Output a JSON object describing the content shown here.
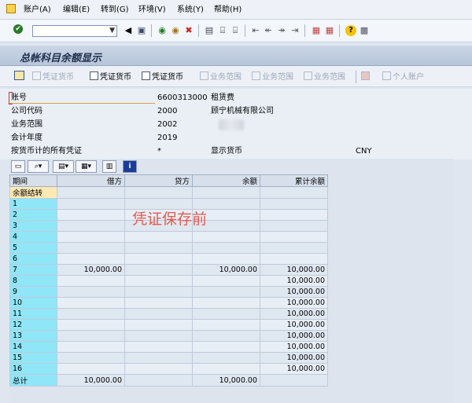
{
  "menu": {
    "items": [
      "账户(A)",
      "编辑(E)",
      "转到(G)",
      "环境(V)",
      "系统(Y)",
      "帮助(H)"
    ]
  },
  "title": "总帐科目余额显示",
  "app_toolbar": {
    "items": [
      {
        "label": "凭证货币",
        "enabled": false,
        "icon": "doc-currency-icon"
      },
      {
        "label": "凭证货币",
        "enabled": true,
        "icon": "doc-currency-icon"
      },
      {
        "label": "凭证货币",
        "enabled": true,
        "icon": "doc-currency-icon"
      },
      {
        "label": "业务范围",
        "enabled": false,
        "icon": "business-area-icon"
      },
      {
        "label": "业务范围",
        "enabled": false,
        "icon": "business-area-icon"
      },
      {
        "label": "业务范围",
        "enabled": false,
        "icon": "business-area-icon"
      },
      {
        "label": "个人账户",
        "enabled": false,
        "icon": "personal-account-icon"
      }
    ]
  },
  "header": {
    "account_label": "账号",
    "account_value": "6600313000",
    "account_desc": "租赁费",
    "company_label": "公司代码",
    "company_value": "2000",
    "company_desc": "顾宁机械有限公司",
    "bus_area_label": "业务范围",
    "bus_area_value": "2002",
    "fiscal_year_label": "会计年度",
    "fiscal_year_value": "2019",
    "doc_currency_label": "按货币计的所有凭证",
    "doc_currency_value": "*",
    "display_currency_label": "显示货币",
    "display_currency_value": "CNY"
  },
  "grid": {
    "columns": [
      "期间",
      "借方",
      "贷方",
      "余额",
      "累计余额"
    ],
    "rows": [
      {
        "period": "余额结转",
        "debit": "",
        "credit": "",
        "balance": "",
        "cumulative": ""
      },
      {
        "period": "1",
        "debit": "",
        "credit": "",
        "balance": "",
        "cumulative": ""
      },
      {
        "period": "2",
        "debit": "",
        "credit": "",
        "balance": "",
        "cumulative": ""
      },
      {
        "period": "3",
        "debit": "",
        "credit": "",
        "balance": "",
        "cumulative": ""
      },
      {
        "period": "4",
        "debit": "",
        "credit": "",
        "balance": "",
        "cumulative": ""
      },
      {
        "period": "5",
        "debit": "",
        "credit": "",
        "balance": "",
        "cumulative": ""
      },
      {
        "period": "6",
        "debit": "",
        "credit": "",
        "balance": "",
        "cumulative": ""
      },
      {
        "period": "7",
        "debit": "10,000.00",
        "credit": "",
        "balance": "10,000.00",
        "cumulative": "10,000.00"
      },
      {
        "period": "8",
        "debit": "",
        "credit": "",
        "balance": "",
        "cumulative": "10,000.00"
      },
      {
        "period": "9",
        "debit": "",
        "credit": "",
        "balance": "",
        "cumulative": "10,000.00"
      },
      {
        "period": "10",
        "debit": "",
        "credit": "",
        "balance": "",
        "cumulative": "10,000.00"
      },
      {
        "period": "11",
        "debit": "",
        "credit": "",
        "balance": "",
        "cumulative": "10,000.00"
      },
      {
        "period": "12",
        "debit": "",
        "credit": "",
        "balance": "",
        "cumulative": "10,000.00"
      },
      {
        "period": "13",
        "debit": "",
        "credit": "",
        "balance": "",
        "cumulative": "10,000.00"
      },
      {
        "period": "14",
        "debit": "",
        "credit": "",
        "balance": "",
        "cumulative": "10,000.00"
      },
      {
        "period": "15",
        "debit": "",
        "credit": "",
        "balance": "",
        "cumulative": "10,000.00"
      },
      {
        "period": "16",
        "debit": "",
        "credit": "",
        "balance": "",
        "cumulative": "10,000.00"
      },
      {
        "period": "总计",
        "debit": "10,000.00",
        "credit": "",
        "balance": "10,000.00",
        "cumulative": ""
      }
    ]
  },
  "overlay_text": "凭证保存前",
  "colors": {
    "key_column": "#8fe6f7",
    "overlay_text": "#e25b4f",
    "title_text": "#1f2f4c"
  }
}
